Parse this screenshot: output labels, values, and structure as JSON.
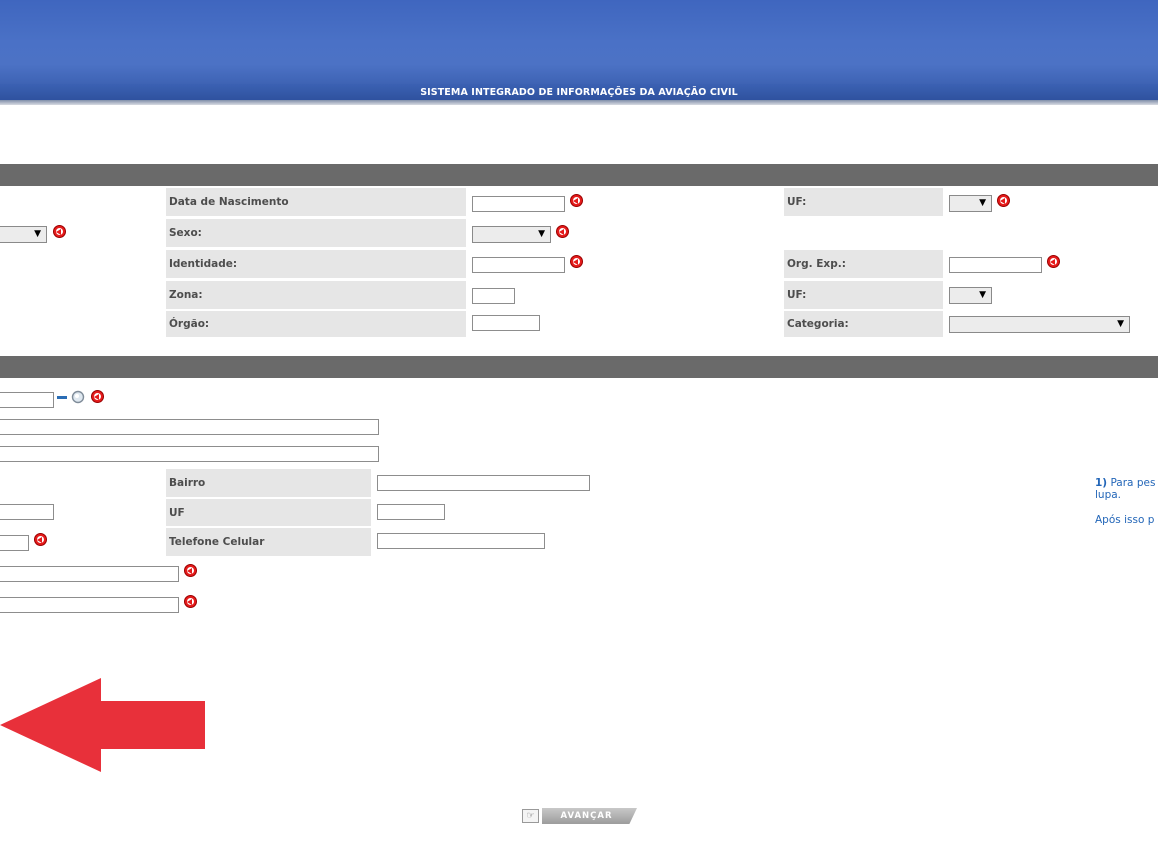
{
  "header": {
    "title": "SISTEMA INTEGRADO DE INFORMAÇÕES DA AVIAÇÃO CIVIL"
  },
  "personal": {
    "birth_date_label": "Data de Nascimento",
    "uf_label": "UF:",
    "sex_label": "Sexo:",
    "identity_label": "Identidade:",
    "org_exp_label": "Org. Exp.:",
    "zone_label": "Zona:",
    "uf2_label": "UF:",
    "organ_label": "Órgão:",
    "category_label": "Categoria:"
  },
  "address": {
    "neighborhood_label": "Bairro",
    "uf_label": "UF",
    "mobile_label": "Telefone Celular"
  },
  "hint": {
    "line1_number": "1)",
    "line1_text": " Para pes",
    "line2": "lupa.",
    "line3": "Após isso p"
  },
  "actions": {
    "advance_label": "AVANÇAR"
  },
  "colors": {
    "header": "#4a71c6",
    "section_bar": "#6a6a6a",
    "label_bg": "#e6e6e6",
    "required": "#e51b1b",
    "hint": "#2366b8",
    "arrow": "#e8303a"
  }
}
